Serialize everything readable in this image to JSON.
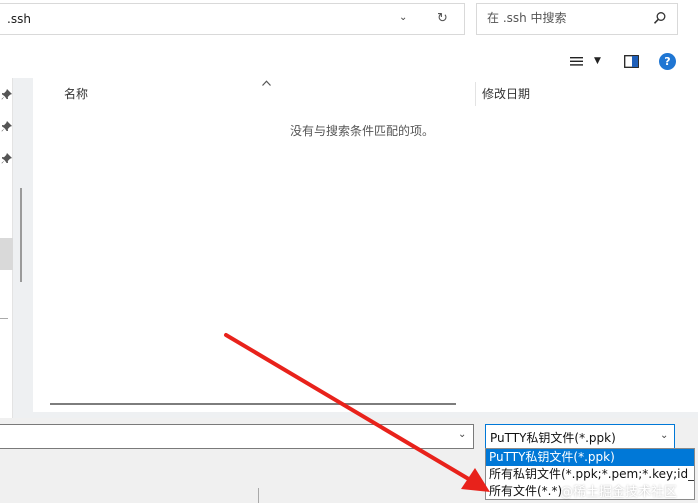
{
  "address_bar": {
    "path": ".ssh",
    "dropdown_icon": "chevron-down-icon",
    "refresh_icon": "refresh-icon"
  },
  "search": {
    "placeholder": "在 .ssh 中搜索",
    "icon": "search-icon"
  },
  "toolbar": {
    "view_icon": "view-list-icon",
    "view_dropdown_icon": "caret-down-icon",
    "pane_icon": "preview-pane-icon",
    "help_label": "?"
  },
  "file_list": {
    "columns": [
      "名称",
      "修改日期"
    ],
    "sort_icon": "sort-up-icon",
    "empty_message": "没有与搜索条件匹配的项。"
  },
  "nav_pane": {
    "pin_icon": "pin-icon",
    "pins": 3
  },
  "file_name": {
    "value": ""
  },
  "file_type": {
    "selected": "PuTTY私钥文件(*.ppk)",
    "options": [
      "PuTTY私钥文件(*.ppk)",
      "所有私钥文件(*.ppk;*.pem;*.key;id_*)",
      "所有文件(*.*)"
    ],
    "highlighted_index": 0
  },
  "watermark": "@稀土掘金技术社区",
  "colors": {
    "accent": "#0078d7",
    "arrow": "#e8221b",
    "help": "#1f76d3",
    "content_bg": "#eef0f2"
  }
}
